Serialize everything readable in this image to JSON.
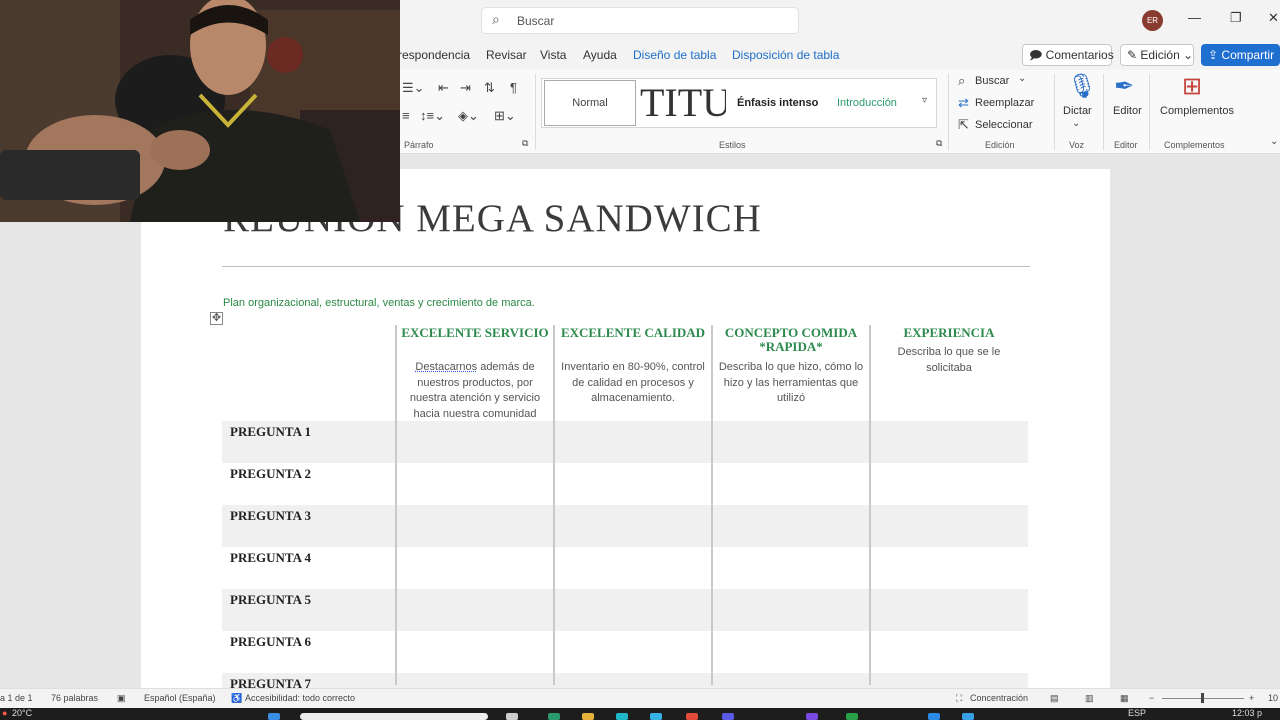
{
  "titlebar": {
    "search_placeholder": "Buscar",
    "user_initials": "ER"
  },
  "menu": {
    "tabs": [
      "respondencia",
      "Revisar",
      "Vista",
      "Ayuda"
    ],
    "context_tabs": [
      "Diseño de tabla",
      "Disposición de tabla"
    ],
    "comments": "Comentarios",
    "editing": "Edición",
    "share": "Compartir"
  },
  "ribbon": {
    "paragraph_label": "Párrafo",
    "styles": {
      "label": "Estilos",
      "normal": "Normal",
      "titulo": "TITU",
      "enfasis": "Énfasis intenso",
      "intro": "Introducción"
    },
    "edicion": {
      "label": "Edición",
      "buscar": "Buscar",
      "reemplazar": "Reemplazar",
      "seleccionar": "Seleccionar"
    },
    "voz": {
      "label": "Voz",
      "dictar": "Dictar"
    },
    "editor": {
      "label": "Editor",
      "button": "Editor"
    },
    "complementos": {
      "label": "Complementos",
      "button": "Complementos"
    }
  },
  "document": {
    "title": "REUNIÓN MEGA SANDWICH",
    "subtitle": "Plan organizacional, estructural, ventas y crecimiento de marca.",
    "columns": [
      {
        "heading": "EXCELENTE SERVICIO",
        "desc_first": "Destacarnos",
        "desc": " además de nuestros productos, por nuestra atención y servicio hacia nuestra comunidad"
      },
      {
        "heading": "EXCELENTE CALIDAD",
        "desc": "Inventario en 80-90%, control de calidad en procesos y almacenamiento."
      },
      {
        "heading": "CONCEPTO COMIDA *RAPIDA*",
        "desc": "Describa lo que hizo, cómo lo hizo y las herramientas que utilizó"
      },
      {
        "heading": "EXPERIENCIA",
        "desc": "Describa lo que se le solicitaba"
      }
    ],
    "rows": [
      "PREGUNTA 1",
      "PREGUNTA 2",
      "PREGUNTA 3",
      "PREGUNTA 4",
      "PREGUNTA 5",
      "PREGUNTA 6",
      "PREGUNTA 7"
    ]
  },
  "statusbar": {
    "page": "a 1 de 1",
    "words": "76 palabras",
    "language": "Español (España)",
    "accessibility": "Accesibilidad: todo correcto",
    "focus": "Concentración",
    "zoom": "10"
  },
  "taskbar": {
    "temperature": "20°C",
    "time": "12:03 p",
    "lang": "ESP"
  },
  "colors": {
    "accent_green": "#2d8a4e",
    "context_blue": "#1e6fc8",
    "share_blue": "#1f6fd1"
  }
}
